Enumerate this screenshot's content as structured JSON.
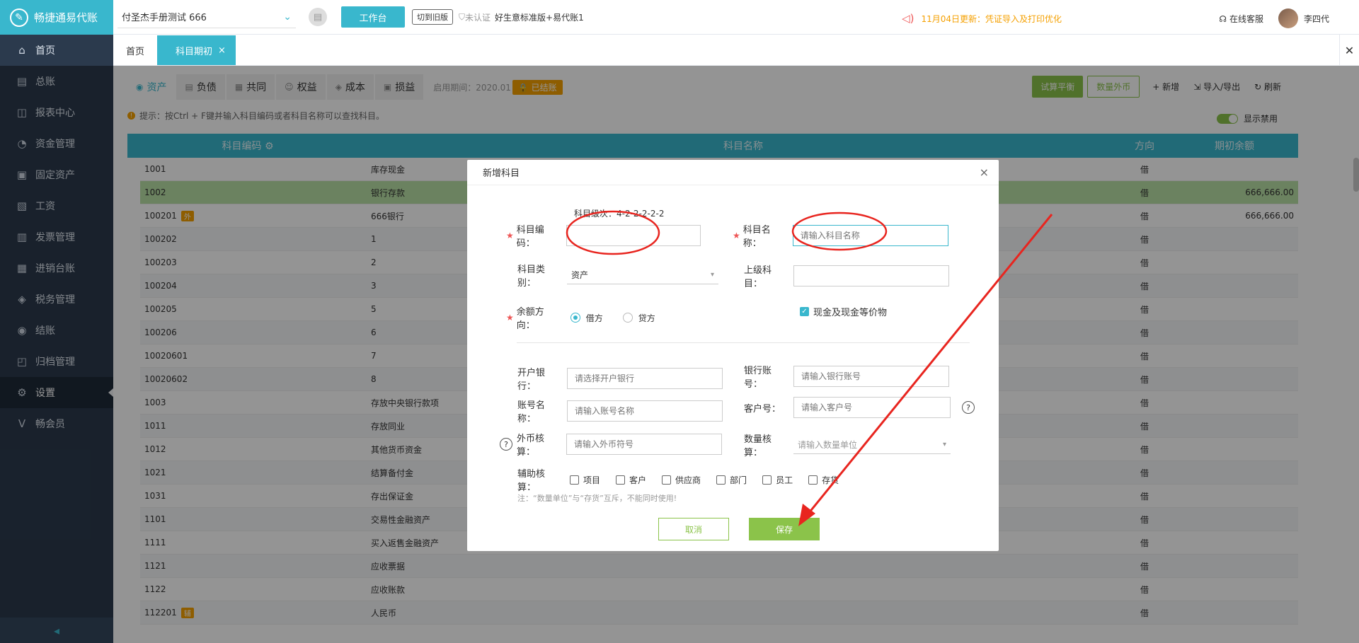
{
  "app": {
    "logo_text": "畅捷通易代账"
  },
  "sidebar": {
    "items": [
      {
        "label": "首页",
        "icon": "home-icon",
        "glyph": "⌂"
      },
      {
        "label": "总账",
        "icon": "ledger-icon",
        "glyph": "▤"
      },
      {
        "label": "报表中心",
        "icon": "chart-icon",
        "glyph": "◫"
      },
      {
        "label": "资金管理",
        "icon": "money-bag-icon",
        "glyph": "◔"
      },
      {
        "label": "固定资产",
        "icon": "asset-icon",
        "glyph": "▣"
      },
      {
        "label": "工资",
        "icon": "salary-icon",
        "glyph": "▧"
      },
      {
        "label": "发票管理",
        "icon": "invoice-icon",
        "glyph": "▥"
      },
      {
        "label": "进销台账",
        "icon": "inventory-icon",
        "glyph": "▦"
      },
      {
        "label": "税务管理",
        "icon": "tax-icon",
        "glyph": "◈"
      },
      {
        "label": "结账",
        "icon": "checkout-icon",
        "glyph": "◉"
      },
      {
        "label": "归档管理",
        "icon": "archive-icon",
        "glyph": "◰"
      },
      {
        "label": "设置",
        "icon": "gear-icon",
        "glyph": "⚙",
        "active": true
      },
      {
        "label": "畅会员",
        "icon": "vip-icon",
        "glyph": "V"
      }
    ],
    "collapse_glyph": "◂"
  },
  "topbar": {
    "company": "付圣杰手册测试 666",
    "workbench_label": "工作台",
    "switch_old_label": "切到旧版",
    "cert_status": "未认证",
    "plan": "好生意标准版+易代账1",
    "notice": "11月04日更新：凭证导入及打印优化",
    "service_label": "在线客服",
    "user_name": "李四代"
  },
  "tabs": [
    {
      "label": "首页"
    },
    {
      "label": "科目期初",
      "active": true
    }
  ],
  "subtabs": {
    "items": [
      "资产",
      "负债",
      "共同",
      "权益",
      "成本",
      "损益"
    ],
    "period_label": "启用期间：2020.01",
    "settled_label": "已结账",
    "actions": {
      "trial_balance": "试算平衡",
      "qty_fx": "数量外币",
      "add": "新增",
      "import_export": "导入/导出",
      "refresh": "刷新"
    },
    "hint": "提示：按Ctrl + F键并输入科目编码或者科目名称可以查找科目。",
    "toggle_label": "显示禁用"
  },
  "table": {
    "headers": [
      "科目编码",
      "科目名称",
      "方向",
      "期初余额"
    ],
    "rows": [
      {
        "code": "1001",
        "name": "库存现金",
        "dir": "借",
        "bal": ""
      },
      {
        "code": "1002",
        "name": "银行存款",
        "dir": "借",
        "bal": "666,666.00",
        "selected": true
      },
      {
        "code": "100201",
        "badge": "外",
        "name": "666银行",
        "dir": "借",
        "bal": "666,666.00"
      },
      {
        "code": "100202",
        "name": "1",
        "dir": "借",
        "bal": ""
      },
      {
        "code": "100203",
        "name": "2",
        "dir": "借",
        "bal": ""
      },
      {
        "code": "100204",
        "name": "3",
        "dir": "借",
        "bal": ""
      },
      {
        "code": "100205",
        "name": "5",
        "dir": "借",
        "bal": ""
      },
      {
        "code": "100206",
        "name": "6",
        "dir": "借",
        "bal": ""
      },
      {
        "code": "10020601",
        "name": "7",
        "dir": "借",
        "bal": ""
      },
      {
        "code": "10020602",
        "name": "8",
        "dir": "借",
        "bal": ""
      },
      {
        "code": "1003",
        "name": "存放中央银行款项",
        "dir": "借",
        "bal": ""
      },
      {
        "code": "1011",
        "name": "存放同业",
        "dir": "借",
        "bal": ""
      },
      {
        "code": "1012",
        "name": "其他货币资金",
        "dir": "借",
        "bal": ""
      },
      {
        "code": "1021",
        "name": "结算备付金",
        "dir": "借",
        "bal": ""
      },
      {
        "code": "1031",
        "name": "存出保证金",
        "dir": "借",
        "bal": ""
      },
      {
        "code": "1101",
        "name": "交易性金融资产",
        "dir": "借",
        "bal": ""
      },
      {
        "code": "1111",
        "name": "买入返售金融资产",
        "dir": "借",
        "bal": ""
      },
      {
        "code": "1121",
        "name": "应收票据",
        "dir": "借",
        "bal": ""
      },
      {
        "code": "1122",
        "name": "应收账款",
        "dir": "借",
        "bal": ""
      },
      {
        "code": "112201",
        "badge": "辅",
        "name": "人民币",
        "dir": "借",
        "bal": ""
      }
    ]
  },
  "modal": {
    "title": "新增科目",
    "level_hint": "科目级次：4-2-2-2-2-2",
    "code_label": "科目编码：",
    "code_value": "",
    "name_label": "科目名称：",
    "name_placeholder": "请输入科目名称",
    "category_label": "科目类别：",
    "category_value": "资产",
    "parent_label": "上级科目：",
    "parent_value": "",
    "direction_label": "余额方向：",
    "debit_label": "借方",
    "credit_label": "贷方",
    "cash_equiv_label": "现金及现金等价物",
    "bank_label": "开户银行：",
    "bank_placeholder": "请选择开户银行",
    "account_no_label": "银行账号：",
    "account_no_placeholder": "请输入银行账号",
    "account_name_label": "账号名称：",
    "account_name_placeholder": "请输入账号名称",
    "customer_no_label": "客户号：",
    "customer_no_placeholder": "请输入客户号",
    "fx_label": "外币核算：",
    "fx_placeholder": "请输入外币符号",
    "qty_label": "数量核算：",
    "qty_placeholder": "请输入数量单位",
    "aux_label": "辅助核算：",
    "aux_items": [
      "项目",
      "客户",
      "供应商",
      "部门",
      "员工",
      "存货"
    ],
    "note": "注：“数量单位”与“存货”互斥，不能同时使用!",
    "cancel_label": "取消",
    "save_label": "保存"
  },
  "colors": {
    "accent": "#39b7cd",
    "green": "#8bc34a",
    "orange": "#f5a000",
    "annotation": "#e8251f"
  }
}
